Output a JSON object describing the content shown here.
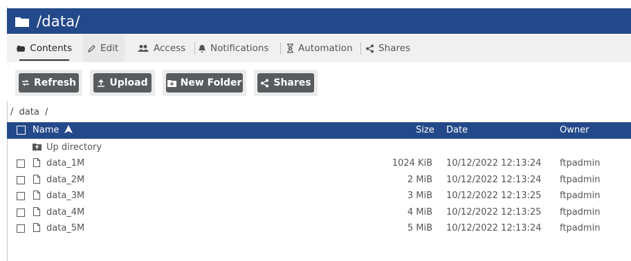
{
  "title": "/data/",
  "tabs": [
    {
      "label": "Contents",
      "icon": "folder-open-icon"
    },
    {
      "label": "Edit",
      "icon": "pencil-icon"
    },
    {
      "label": "Access",
      "icon": "users-icon"
    },
    {
      "label": "Notifications",
      "icon": "bell-icon"
    },
    {
      "label": "Automation",
      "icon": "hourglass-icon"
    },
    {
      "label": "Shares",
      "icon": "share-icon"
    }
  ],
  "toolbar": {
    "refresh": "Refresh",
    "upload": "Upload",
    "new_folder": "New Folder",
    "shares": "Shares"
  },
  "breadcrumb": [
    "/",
    "data",
    "/"
  ],
  "table": {
    "headers": {
      "name": "Name",
      "size": "Size",
      "date": "Date",
      "owner": "Owner"
    },
    "up_directory": "Up directory",
    "rows": [
      {
        "name": "data_1M",
        "size": "1024 KiB",
        "date": "10/12/2022 12:13:24",
        "owner": "ftpadmin"
      },
      {
        "name": "data_2M",
        "size": "2 MiB",
        "date": "10/12/2022 12:13:24",
        "owner": "ftpadmin"
      },
      {
        "name": "data_3M",
        "size": "3 MiB",
        "date": "10/12/2022 12:13:25",
        "owner": "ftpadmin"
      },
      {
        "name": "data_4M",
        "size": "4 MiB",
        "date": "10/12/2022 12:13:25",
        "owner": "ftpadmin"
      },
      {
        "name": "data_5M",
        "size": "5 MiB",
        "date": "10/12/2022 12:13:24",
        "owner": "ftpadmin"
      }
    ]
  },
  "colors": {
    "header_bg": "#24498a",
    "button_bg": "#585c5f",
    "tab_bg": "#f0f0f0"
  }
}
